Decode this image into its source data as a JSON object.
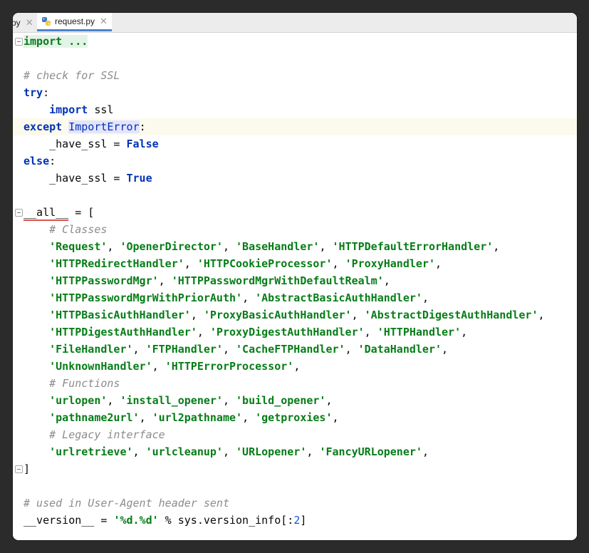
{
  "tabs": [
    {
      "label": "py",
      "active": false
    },
    {
      "label": "request.py",
      "active": true,
      "icon": "python-file-icon"
    }
  ],
  "colors": {
    "keyword": "#0033b3",
    "string": "#067d17",
    "comment": "#8c8c8c",
    "number": "#1750eb",
    "caret_line": "#fcfaed",
    "tab_underline": "#4b83c9"
  },
  "editor": {
    "caret_line_index": 5,
    "lines": [
      {
        "tokens": [
          [
            "folded",
            "import ..."
          ]
        ],
        "fold": true
      },
      {
        "tokens": []
      },
      {
        "tokens": [
          [
            "cmt",
            "# check for SSL"
          ]
        ]
      },
      {
        "tokens": [
          [
            "kw",
            "try"
          ],
          [
            "txt",
            ":"
          ]
        ]
      },
      {
        "tokens": [
          [
            "txt",
            "    "
          ],
          [
            "kw",
            "import"
          ],
          [
            "txt",
            " ssl"
          ]
        ]
      },
      {
        "tokens": [
          [
            "kw",
            "except"
          ],
          [
            "txt",
            " "
          ],
          [
            "hl",
            "ImportError"
          ],
          [
            "txt",
            ":"
          ]
        ]
      },
      {
        "tokens": [
          [
            "txt",
            "    _have_ssl = "
          ],
          [
            "kw",
            "False"
          ]
        ]
      },
      {
        "tokens": [
          [
            "kw",
            "else"
          ],
          [
            "txt",
            ":"
          ]
        ]
      },
      {
        "tokens": [
          [
            "txt",
            "    _have_ssl = "
          ],
          [
            "kw",
            "True"
          ]
        ]
      },
      {
        "tokens": []
      },
      {
        "tokens": [
          [
            "dunder",
            "__all__"
          ],
          [
            "txt",
            " = ["
          ]
        ],
        "fold": true
      },
      {
        "tokens": [
          [
            "txt",
            "    "
          ],
          [
            "cmt",
            "# Classes"
          ]
        ]
      },
      {
        "tokens": [
          [
            "txt",
            "    "
          ],
          [
            "str",
            "'Request'"
          ],
          [
            "txt",
            ", "
          ],
          [
            "str",
            "'OpenerDirector'"
          ],
          [
            "txt",
            ", "
          ],
          [
            "str",
            "'BaseHandler'"
          ],
          [
            "txt",
            ", "
          ],
          [
            "str",
            "'HTTPDefaultErrorHandler'"
          ],
          [
            "txt",
            ","
          ]
        ]
      },
      {
        "tokens": [
          [
            "txt",
            "    "
          ],
          [
            "str",
            "'HTTPRedirectHandler'"
          ],
          [
            "txt",
            ", "
          ],
          [
            "str",
            "'HTTPCookieProcessor'"
          ],
          [
            "txt",
            ", "
          ],
          [
            "str",
            "'ProxyHandler'"
          ],
          [
            "txt",
            ","
          ]
        ]
      },
      {
        "tokens": [
          [
            "txt",
            "    "
          ],
          [
            "str",
            "'HTTPPasswordMgr'"
          ],
          [
            "txt",
            ", "
          ],
          [
            "str",
            "'HTTPPasswordMgrWithDefaultRealm'"
          ],
          [
            "txt",
            ","
          ]
        ]
      },
      {
        "tokens": [
          [
            "txt",
            "    "
          ],
          [
            "str",
            "'HTTPPasswordMgrWithPriorAuth'"
          ],
          [
            "txt",
            ", "
          ],
          [
            "str",
            "'AbstractBasicAuthHandler'"
          ],
          [
            "txt",
            ","
          ]
        ]
      },
      {
        "tokens": [
          [
            "txt",
            "    "
          ],
          [
            "str",
            "'HTTPBasicAuthHandler'"
          ],
          [
            "txt",
            ", "
          ],
          [
            "str",
            "'ProxyBasicAuthHandler'"
          ],
          [
            "txt",
            ", "
          ],
          [
            "str",
            "'AbstractDigestAuthHandler'"
          ],
          [
            "txt",
            ","
          ]
        ]
      },
      {
        "tokens": [
          [
            "txt",
            "    "
          ],
          [
            "str",
            "'HTTPDigestAuthHandler'"
          ],
          [
            "txt",
            ", "
          ],
          [
            "str",
            "'ProxyDigestAuthHandler'"
          ],
          [
            "txt",
            ", "
          ],
          [
            "str",
            "'HTTPHandler'"
          ],
          [
            "txt",
            ","
          ]
        ]
      },
      {
        "tokens": [
          [
            "txt",
            "    "
          ],
          [
            "str",
            "'FileHandler'"
          ],
          [
            "txt",
            ", "
          ],
          [
            "str",
            "'FTPHandler'"
          ],
          [
            "txt",
            ", "
          ],
          [
            "str",
            "'CacheFTPHandler'"
          ],
          [
            "txt",
            ", "
          ],
          [
            "str",
            "'DataHandler'"
          ],
          [
            "txt",
            ","
          ]
        ]
      },
      {
        "tokens": [
          [
            "txt",
            "    "
          ],
          [
            "str",
            "'UnknownHandler'"
          ],
          [
            "txt",
            ", "
          ],
          [
            "str",
            "'HTTPErrorProcessor'"
          ],
          [
            "txt",
            ","
          ]
        ]
      },
      {
        "tokens": [
          [
            "txt",
            "    "
          ],
          [
            "cmt",
            "# Functions"
          ]
        ]
      },
      {
        "tokens": [
          [
            "txt",
            "    "
          ],
          [
            "str",
            "'urlopen'"
          ],
          [
            "txt",
            ", "
          ],
          [
            "str",
            "'install_opener'"
          ],
          [
            "txt",
            ", "
          ],
          [
            "str",
            "'build_opener'"
          ],
          [
            "txt",
            ","
          ]
        ]
      },
      {
        "tokens": [
          [
            "txt",
            "    "
          ],
          [
            "str",
            "'pathname2url'"
          ],
          [
            "txt",
            ", "
          ],
          [
            "str",
            "'url2pathname'"
          ],
          [
            "txt",
            ", "
          ],
          [
            "str",
            "'getproxies'"
          ],
          [
            "txt",
            ","
          ]
        ]
      },
      {
        "tokens": [
          [
            "txt",
            "    "
          ],
          [
            "cmt",
            "# Legacy interface"
          ]
        ]
      },
      {
        "tokens": [
          [
            "txt",
            "    "
          ],
          [
            "str",
            "'urlretrieve'"
          ],
          [
            "txt",
            ", "
          ],
          [
            "str",
            "'urlcleanup'"
          ],
          [
            "txt",
            ", "
          ],
          [
            "str",
            "'URLopener'"
          ],
          [
            "txt",
            ", "
          ],
          [
            "str",
            "'FancyURLopener'"
          ],
          [
            "txt",
            ","
          ]
        ]
      },
      {
        "tokens": [
          [
            "txt",
            "]"
          ]
        ],
        "fold": true
      },
      {
        "tokens": []
      },
      {
        "tokens": [
          [
            "cmt",
            "# used in User-Agent header sent"
          ]
        ]
      },
      {
        "tokens": [
          [
            "txt",
            "__version__ = "
          ],
          [
            "str",
            "'%d.%d'"
          ],
          [
            "txt",
            " % sys.version_info[:"
          ],
          [
            "num",
            "2"
          ],
          [
            "txt",
            "]"
          ]
        ]
      }
    ]
  }
}
